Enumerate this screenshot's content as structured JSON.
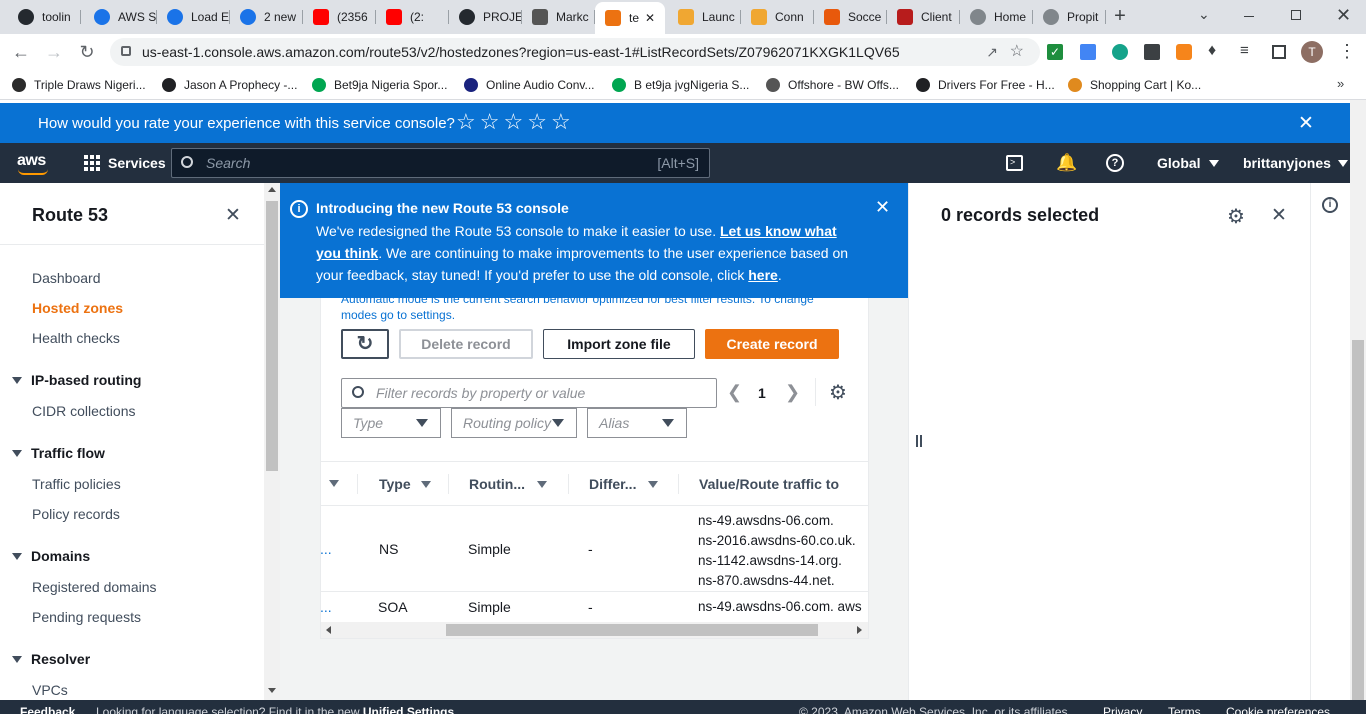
{
  "browser": {
    "tabs": [
      {
        "label": "toolin",
        "icon": "github-icon"
      },
      {
        "label": "AWS S",
        "icon": "blog-icon"
      },
      {
        "label": "Load E",
        "icon": "blog-icon"
      },
      {
        "label": "2 new",
        "icon": "blog-icon"
      },
      {
        "label": "(2356",
        "icon": "youtube-icon"
      },
      {
        "label": "(2:",
        "icon": "youtube-icon"
      },
      {
        "label": "PROJE",
        "icon": "github-icon"
      },
      {
        "label": "Markc",
        "icon": "markdown-icon"
      },
      {
        "label": "te",
        "icon": "aws-route53-icon",
        "active": true
      },
      {
        "label": "Launc",
        "icon": "aws-box-icon"
      },
      {
        "label": "Conn",
        "icon": "aws-box-icon"
      },
      {
        "label": "Socce",
        "icon": "s-icon"
      },
      {
        "label": "Client",
        "icon": "client-icon"
      },
      {
        "label": "Home",
        "icon": "globe-icon"
      },
      {
        "label": "Propit",
        "icon": "globe-icon"
      }
    ],
    "url": "us-east-1.console.aws.amazon.com/route53/v2/hostedzones?region=us-east-1#ListRecordSets/Z07962071KXGK1LQV65",
    "profile_initial": "T",
    "bookmarks": [
      "Triple Draws Nigeri...",
      "Jason A Prophecy -...",
      "Bet9ja Nigeria Spor...",
      "Online Audio Conv...",
      "B et9ja jvgNigeria S...",
      "Offshore - BW Offs...",
      "Drivers For Free - H...",
      "Shopping Cart | Ko..."
    ]
  },
  "feedback_banner": {
    "question": "How would you rate your experience with this service console?",
    "stars": 5
  },
  "aws_nav": {
    "logo": "aws",
    "services": "Services",
    "search_placeholder": "Search",
    "search_shortcut": "[Alt+S]",
    "region": "Global",
    "user": "brittanyjones"
  },
  "sidebar": {
    "title": "Route 53",
    "items": [
      {
        "label": "Dashboard",
        "active": false
      },
      {
        "label": "Hosted zones",
        "active": true
      },
      {
        "label": "Health checks",
        "active": false
      }
    ],
    "sections": [
      {
        "title": "IP-based routing",
        "items": [
          "CIDR collections"
        ]
      },
      {
        "title": "Traffic flow",
        "items": [
          "Traffic policies",
          "Policy records"
        ]
      },
      {
        "title": "Domains",
        "items": [
          "Registered domains",
          "Pending requests"
        ]
      },
      {
        "title": "Resolver",
        "items": [
          "VPCs"
        ]
      }
    ]
  },
  "flash": {
    "title": "Introducing the new Route 53 console",
    "line1_prefix": "We've redesigned the Route 53 console to make it easier to use. ",
    "link1a": "Let us know what",
    "link1b": "you think",
    "line2_suffix": ". We are continuing to make improvements to the user experience based on",
    "line3_prefix": "your feedback, stay tuned! If you'd prefer to use the old console, click ",
    "link2": "here",
    "line3_suffix": "."
  },
  "records": {
    "mode_hint_1": "Automatic mode is the current search behavior optimized for best filter results. To change",
    "mode_hint_2": "modes go to settings.",
    "buttons": {
      "delete": "Delete record",
      "import": "Import zone file",
      "create": "Create record"
    },
    "filter_placeholder": "Filter records by property or value",
    "page": "1",
    "selects": {
      "type": "Type",
      "routing": "Routing policy",
      "alias": "Alias"
    },
    "columns": [
      "Type",
      "Routin...",
      "Differ...",
      "Value/Route traffic to"
    ],
    "rows": [
      {
        "name": "...",
        "type": "NS",
        "routing": "Simple",
        "differ": "-",
        "values": [
          "ns-49.awsdns-06.com.",
          "ns-2016.awsdns-60.co.uk.",
          "ns-1142.awsdns-14.org.",
          "ns-870.awsdns-44.net."
        ]
      },
      {
        "name": "...",
        "type": "SOA",
        "routing": "Simple",
        "differ": "-",
        "values": [
          "ns-49.awsdns-06.com. aws"
        ]
      }
    ]
  },
  "details_panel": {
    "title": "0 records selected"
  },
  "footer": {
    "feedback": "Feedback",
    "language_hint": "Looking for language selection? Find it in the new ",
    "unified": "Unified Settings",
    "copyright": "© 2023, Amazon Web Services, Inc. or its affiliates.",
    "privacy": "Privacy",
    "terms": "Terms",
    "cookies": "Cookie preferences"
  },
  "colors": {
    "aws_nav": "#232f3e",
    "blue": "#0972d3",
    "orange": "#ec7211",
    "active_link": "#ec7211"
  }
}
